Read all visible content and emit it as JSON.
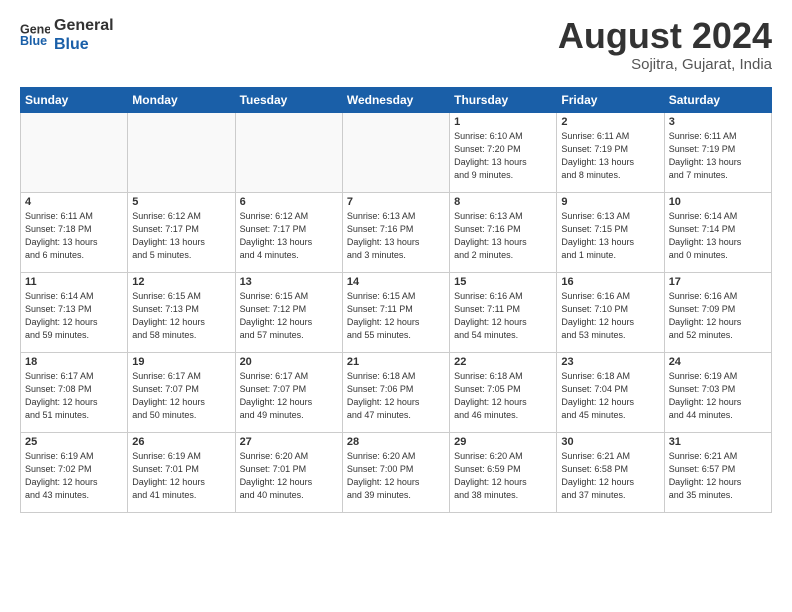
{
  "logo": {
    "general": "General",
    "blue": "Blue"
  },
  "header": {
    "month": "August 2024",
    "location": "Sojitra, Gujarat, India"
  },
  "weekdays": [
    "Sunday",
    "Monday",
    "Tuesday",
    "Wednesday",
    "Thursday",
    "Friday",
    "Saturday"
  ],
  "weeks": [
    [
      {
        "day": "",
        "info": ""
      },
      {
        "day": "",
        "info": ""
      },
      {
        "day": "",
        "info": ""
      },
      {
        "day": "",
        "info": ""
      },
      {
        "day": "1",
        "info": "Sunrise: 6:10 AM\nSunset: 7:20 PM\nDaylight: 13 hours\nand 9 minutes."
      },
      {
        "day": "2",
        "info": "Sunrise: 6:11 AM\nSunset: 7:19 PM\nDaylight: 13 hours\nand 8 minutes."
      },
      {
        "day": "3",
        "info": "Sunrise: 6:11 AM\nSunset: 7:19 PM\nDaylight: 13 hours\nand 7 minutes."
      }
    ],
    [
      {
        "day": "4",
        "info": "Sunrise: 6:11 AM\nSunset: 7:18 PM\nDaylight: 13 hours\nand 6 minutes."
      },
      {
        "day": "5",
        "info": "Sunrise: 6:12 AM\nSunset: 7:17 PM\nDaylight: 13 hours\nand 5 minutes."
      },
      {
        "day": "6",
        "info": "Sunrise: 6:12 AM\nSunset: 7:17 PM\nDaylight: 13 hours\nand 4 minutes."
      },
      {
        "day": "7",
        "info": "Sunrise: 6:13 AM\nSunset: 7:16 PM\nDaylight: 13 hours\nand 3 minutes."
      },
      {
        "day": "8",
        "info": "Sunrise: 6:13 AM\nSunset: 7:16 PM\nDaylight: 13 hours\nand 2 minutes."
      },
      {
        "day": "9",
        "info": "Sunrise: 6:13 AM\nSunset: 7:15 PM\nDaylight: 13 hours\nand 1 minute."
      },
      {
        "day": "10",
        "info": "Sunrise: 6:14 AM\nSunset: 7:14 PM\nDaylight: 13 hours\nand 0 minutes."
      }
    ],
    [
      {
        "day": "11",
        "info": "Sunrise: 6:14 AM\nSunset: 7:13 PM\nDaylight: 12 hours\nand 59 minutes."
      },
      {
        "day": "12",
        "info": "Sunrise: 6:15 AM\nSunset: 7:13 PM\nDaylight: 12 hours\nand 58 minutes."
      },
      {
        "day": "13",
        "info": "Sunrise: 6:15 AM\nSunset: 7:12 PM\nDaylight: 12 hours\nand 57 minutes."
      },
      {
        "day": "14",
        "info": "Sunrise: 6:15 AM\nSunset: 7:11 PM\nDaylight: 12 hours\nand 55 minutes."
      },
      {
        "day": "15",
        "info": "Sunrise: 6:16 AM\nSunset: 7:11 PM\nDaylight: 12 hours\nand 54 minutes."
      },
      {
        "day": "16",
        "info": "Sunrise: 6:16 AM\nSunset: 7:10 PM\nDaylight: 12 hours\nand 53 minutes."
      },
      {
        "day": "17",
        "info": "Sunrise: 6:16 AM\nSunset: 7:09 PM\nDaylight: 12 hours\nand 52 minutes."
      }
    ],
    [
      {
        "day": "18",
        "info": "Sunrise: 6:17 AM\nSunset: 7:08 PM\nDaylight: 12 hours\nand 51 minutes."
      },
      {
        "day": "19",
        "info": "Sunrise: 6:17 AM\nSunset: 7:07 PM\nDaylight: 12 hours\nand 50 minutes."
      },
      {
        "day": "20",
        "info": "Sunrise: 6:17 AM\nSunset: 7:07 PM\nDaylight: 12 hours\nand 49 minutes."
      },
      {
        "day": "21",
        "info": "Sunrise: 6:18 AM\nSunset: 7:06 PM\nDaylight: 12 hours\nand 47 minutes."
      },
      {
        "day": "22",
        "info": "Sunrise: 6:18 AM\nSunset: 7:05 PM\nDaylight: 12 hours\nand 46 minutes."
      },
      {
        "day": "23",
        "info": "Sunrise: 6:18 AM\nSunset: 7:04 PM\nDaylight: 12 hours\nand 45 minutes."
      },
      {
        "day": "24",
        "info": "Sunrise: 6:19 AM\nSunset: 7:03 PM\nDaylight: 12 hours\nand 44 minutes."
      }
    ],
    [
      {
        "day": "25",
        "info": "Sunrise: 6:19 AM\nSunset: 7:02 PM\nDaylight: 12 hours\nand 43 minutes."
      },
      {
        "day": "26",
        "info": "Sunrise: 6:19 AM\nSunset: 7:01 PM\nDaylight: 12 hours\nand 41 minutes."
      },
      {
        "day": "27",
        "info": "Sunrise: 6:20 AM\nSunset: 7:01 PM\nDaylight: 12 hours\nand 40 minutes."
      },
      {
        "day": "28",
        "info": "Sunrise: 6:20 AM\nSunset: 7:00 PM\nDaylight: 12 hours\nand 39 minutes."
      },
      {
        "day": "29",
        "info": "Sunrise: 6:20 AM\nSunset: 6:59 PM\nDaylight: 12 hours\nand 38 minutes."
      },
      {
        "day": "30",
        "info": "Sunrise: 6:21 AM\nSunset: 6:58 PM\nDaylight: 12 hours\nand 37 minutes."
      },
      {
        "day": "31",
        "info": "Sunrise: 6:21 AM\nSunset: 6:57 PM\nDaylight: 12 hours\nand 35 minutes."
      }
    ]
  ]
}
